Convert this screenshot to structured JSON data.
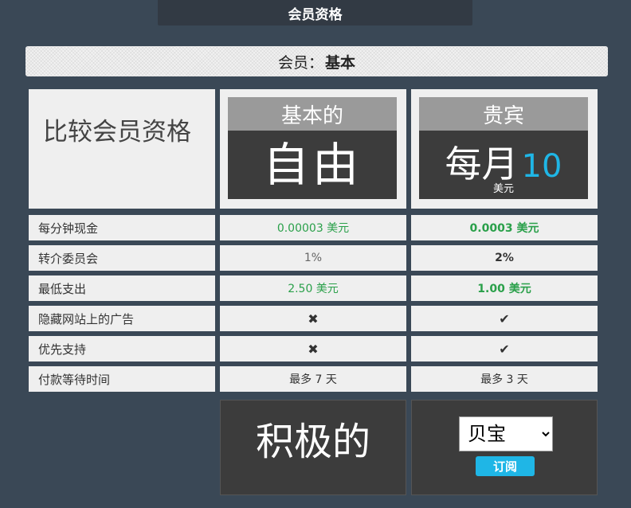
{
  "header": {
    "title": "会员资格"
  },
  "membership": {
    "label": "会员：",
    "level": "基本"
  },
  "comparison": {
    "title": "比较会员资格",
    "plans": [
      {
        "name": "基本的",
        "price": "自由"
      },
      {
        "name": "贵宾",
        "price_prefix": "每月",
        "price_amount": "10",
        "price_unit": "美元"
      }
    ],
    "rows": [
      {
        "label": "每分钟现金",
        "basic": "0.00003 美元",
        "vip": "0.0003 美元"
      },
      {
        "label": "转介委员会",
        "basic": "1%",
        "vip": "2%"
      },
      {
        "label": "最低支出",
        "basic": "2.50 美元",
        "vip": "1.00 美元"
      },
      {
        "label": "隐藏网站上的广告",
        "basic_icon": "cross-icon",
        "vip_icon": "check-icon"
      },
      {
        "label": "优先支持",
        "basic_icon": "cross-icon",
        "vip_icon": "check-icon"
      },
      {
        "label": "付款等待时间",
        "basic": "最多 7 天",
        "vip": "最多 3 天"
      }
    ]
  },
  "footer": {
    "active_label": "积极的",
    "select_value": "贝宝",
    "subscribe_label": "订阅"
  },
  "colors": {
    "accent": "#1fb6e6",
    "green": "#2aa04a",
    "background": "#3a4856"
  }
}
